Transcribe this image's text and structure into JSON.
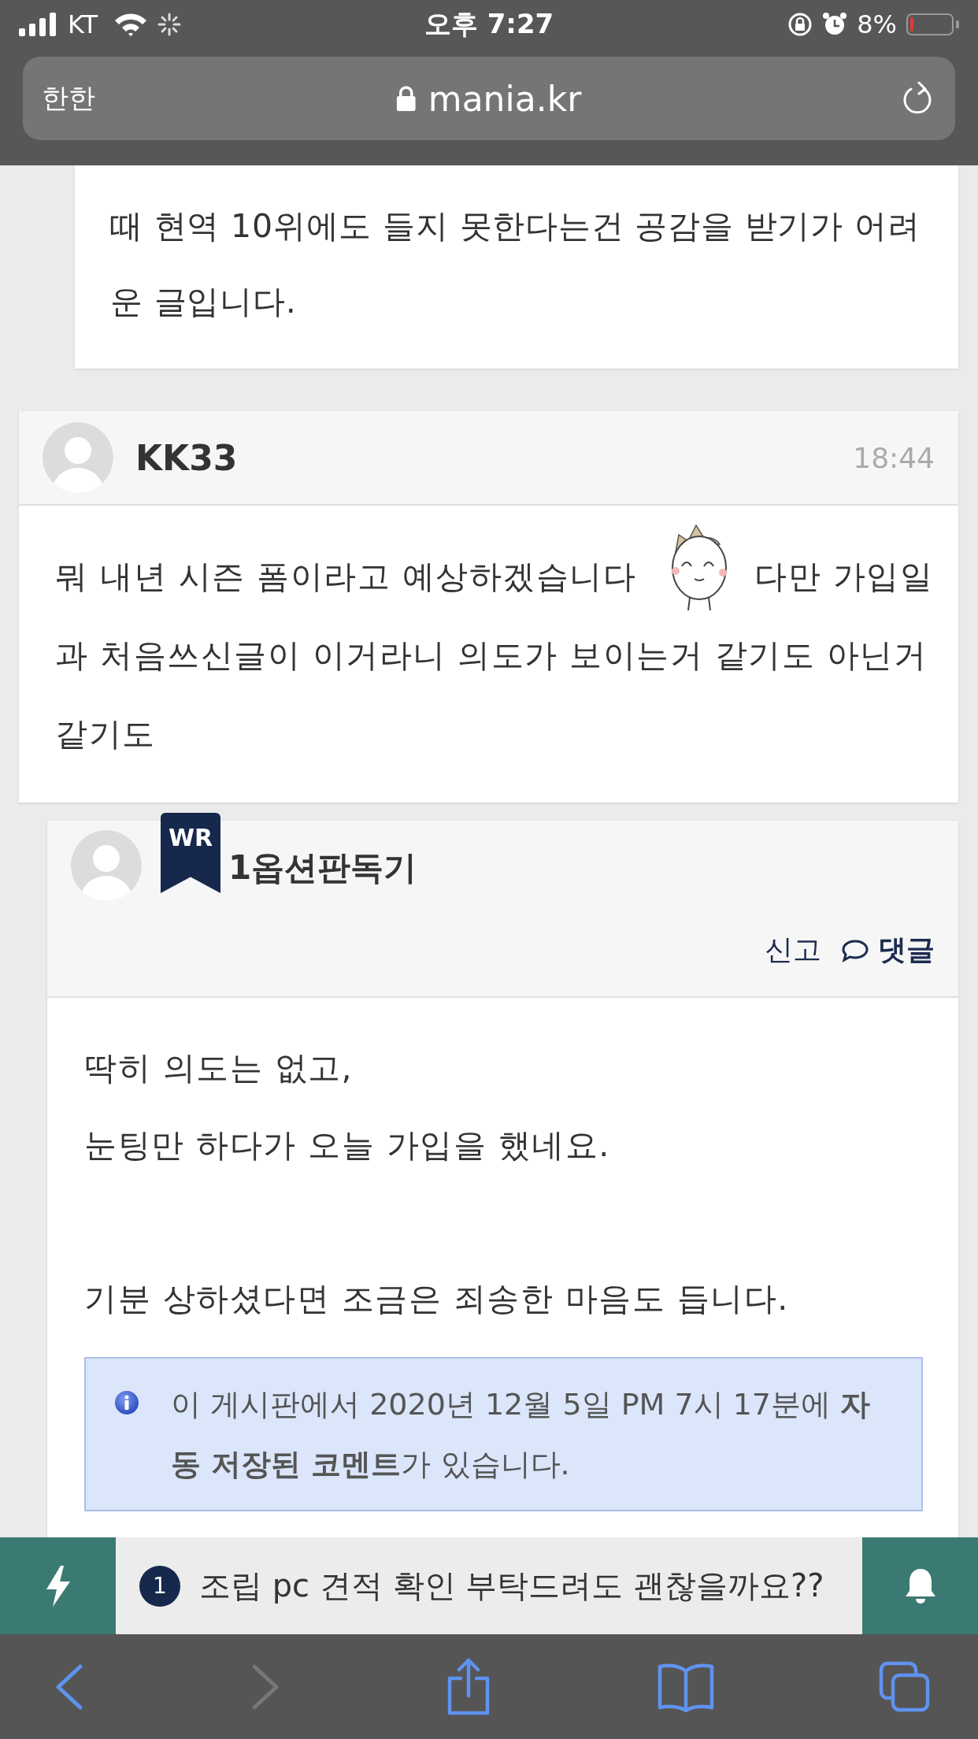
{
  "status_bar": {
    "carrier": "KT",
    "time": "오후 7:27",
    "battery": "8%"
  },
  "browser": {
    "reader_label": "한한",
    "url": "mania.kr"
  },
  "previous_comment": {
    "text": "때 현역 10위에도 들지 못한다는건 공감을 받기가 어려운 글입니다."
  },
  "comment": {
    "author": "KK33",
    "time": "18:44",
    "body": [
      {
        "kind": "text",
        "text": "뭐 내년 시즌 폼이라고 예상하겠습니다"
      },
      {
        "kind": "emoticon"
      },
      {
        "kind": "text",
        "text": "다만 가입일과 처음쓰신글이 이거라니 의도가 보이는거 같기도 아닌거 같기도"
      }
    ]
  },
  "reply": {
    "author": "1옵션판독기",
    "writer_badge": "WR",
    "actions": [
      {
        "kind": "report",
        "label": "신고"
      },
      {
        "kind": "reply",
        "label": "댓글"
      }
    ],
    "paragraph_groups": [
      [
        "딱히 의도는 없고,",
        "눈팅만 하다가 오늘 가입을 했네요."
      ],
      [
        "기분 상하셨다면 조금은 죄송한 마음도 듭니다."
      ]
    ],
    "notice": "이 게시판에서 2020년 12월 5일 PM 7시 17분에 **자동 저장된 코멘트**가 있습니다."
  },
  "notification_bar": {
    "count": "1",
    "text": "조립 pc 견적 확인 부탁드려도 괜찮을까요??"
  },
  "toolbar": [
    {
      "kind": "back",
      "disabled": false
    },
    {
      "kind": "forward",
      "disabled": true
    },
    {
      "kind": "share",
      "disabled": false
    },
    {
      "kind": "bookmarks",
      "disabled": false
    },
    {
      "kind": "tabs",
      "disabled": false
    }
  ]
}
